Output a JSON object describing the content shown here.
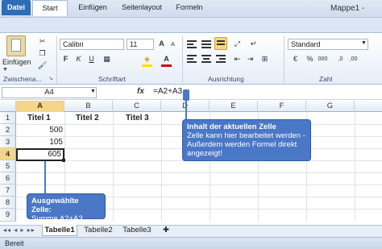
{
  "window": {
    "title": "Mappe1 -"
  },
  "quick_access": {
    "save_icon": "💾",
    "undo_icon": "↶",
    "redo_icon": "↷"
  },
  "tabs": [
    "Datei",
    "Start",
    "Einfügen",
    "Seitenlayout",
    "Formeln"
  ],
  "ribbon": {
    "clipboard": {
      "paste_label": "Einfügen",
      "group_label": "Zwischena..."
    },
    "font": {
      "name": "Calibri",
      "size": "11",
      "bold": "F",
      "italic": "K",
      "underline": "U",
      "grow": "A",
      "shrink": "A",
      "group_label": "Schriftart"
    },
    "alignment": {
      "group_label": "Ausrichtung"
    },
    "number": {
      "format": "Standard",
      "group_label": "Zahl"
    }
  },
  "formula_bar": {
    "name_box": "A4",
    "fx": "fx",
    "formula": "=A2+A3"
  },
  "columns": [
    "A",
    "B",
    "C",
    "D",
    "E",
    "F",
    "G"
  ],
  "rows": [
    "1",
    "2",
    "3",
    "4",
    "5",
    "6",
    "7",
    "8",
    "9"
  ],
  "cells": {
    "A1": "Titel 1",
    "B1": "Titel 2",
    "C1": "Titel 3",
    "A2": "500",
    "A3": "105",
    "A4": "605"
  },
  "callouts": {
    "formula_title": "Inhalt der aktuellen Zelle",
    "formula_line1": "Zelle kann hier bearbeitet werden -",
    "formula_line2": "Außerdem werden Formel direkt",
    "formula_line3": "angezeigt!",
    "cell_title": "Ausgewählte Zelle:",
    "cell_line1": "Summe A2+A3"
  },
  "sheets": [
    "Tabelle1",
    "Tabelle2",
    "Tabelle3"
  ],
  "status": "Bereit",
  "colors": {
    "accent": "#2e6db5",
    "callout": "#4a77c6",
    "selection": "#f0c060"
  }
}
